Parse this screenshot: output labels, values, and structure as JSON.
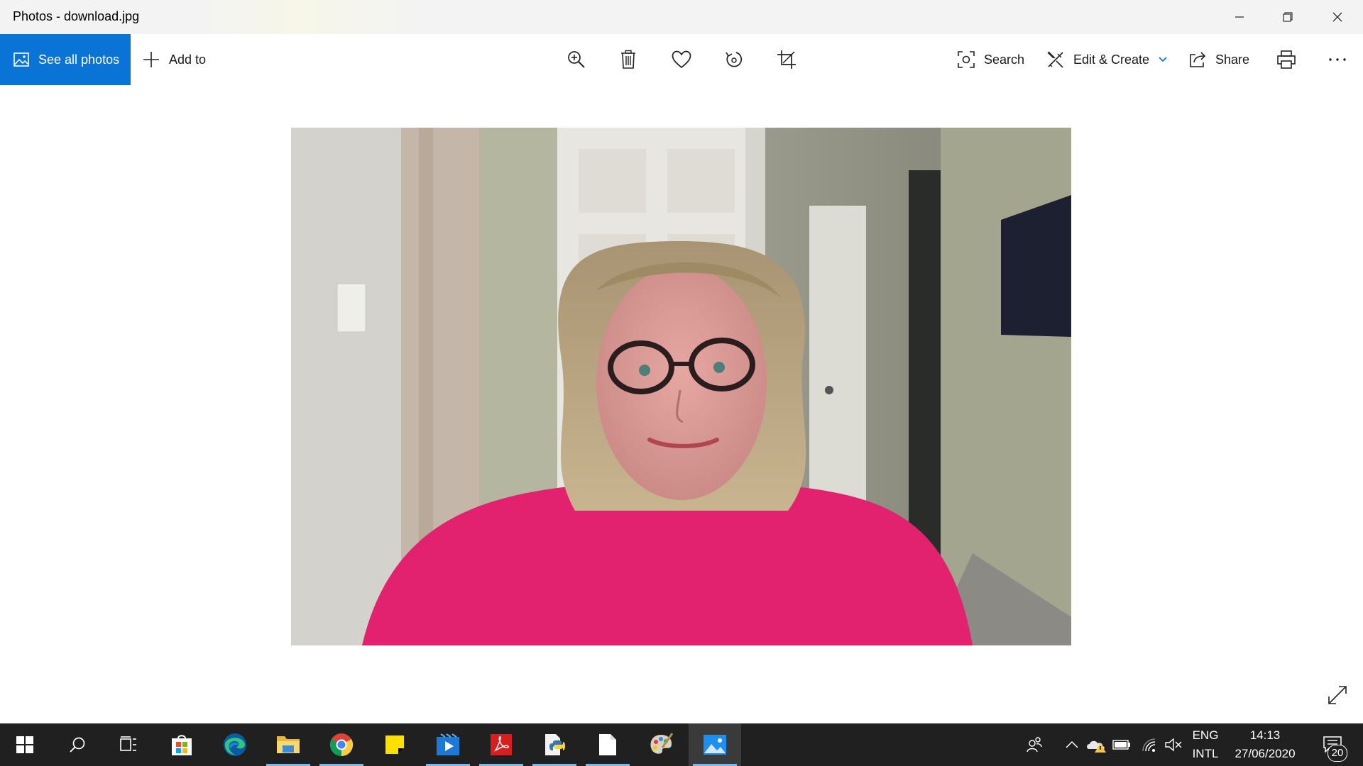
{
  "window": {
    "title": "Photos - download.jpg"
  },
  "toolbar": {
    "see_all_photos": "See all photos",
    "add_to": "Add to",
    "search": "Search",
    "edit_create": "Edit & Create",
    "share": "Share",
    "icons": [
      "zoom-in-icon",
      "delete-icon",
      "favorite-heart-icon",
      "rotate-icon",
      "crop-icon",
      "print-icon",
      "more-icon"
    ]
  },
  "colors": {
    "accent": "#0a74d6",
    "taskbar": "#202020",
    "shirt": "#e2216f"
  },
  "taskbar": {
    "apps": [
      "start",
      "search",
      "task-view",
      "microsoft-store",
      "edge",
      "file-explorer",
      "chrome",
      "sticky-notes",
      "media-player",
      "acrobat-reader",
      "python",
      "notepad",
      "paint",
      "photos"
    ],
    "language_top": "ENG",
    "language_bottom": "INTL",
    "time": "14:13",
    "date": "27/06/2020",
    "notification_count": "20"
  }
}
